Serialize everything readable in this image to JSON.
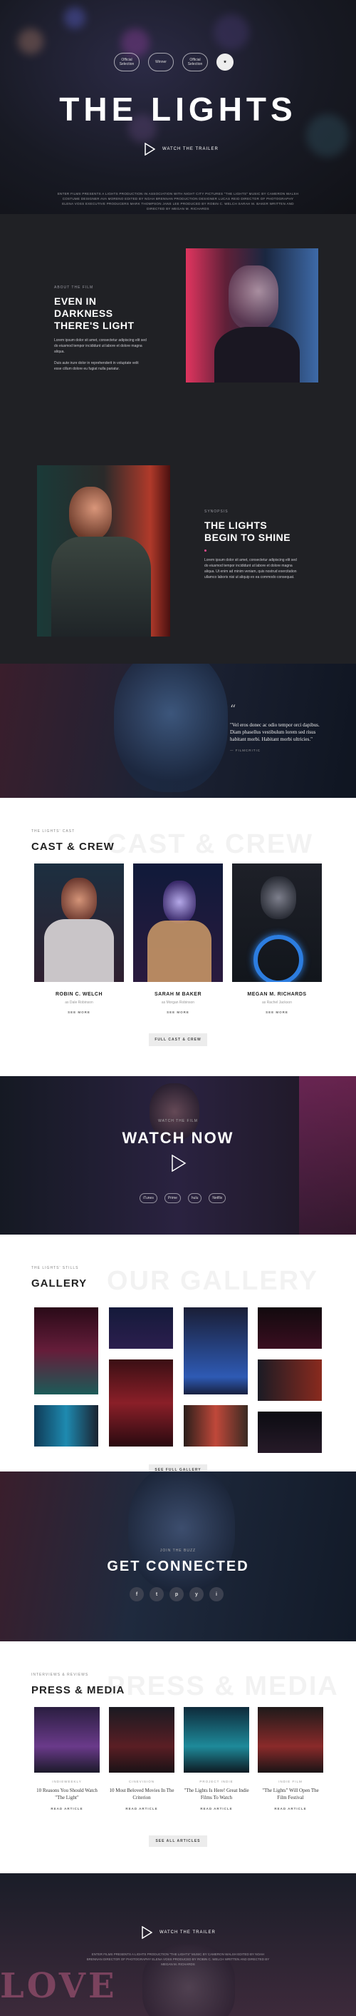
{
  "hero": {
    "awards": [
      "Official Selection",
      "Winner",
      "Official Selection"
    ],
    "title": "THE LIGHTS",
    "trailer_label": "WATCH THE TRAILER",
    "credits": "ENTER FILMS PRESENTS A LIGHTS PRODUCTION IN ASSOCIATION WITH NIGHT CITY PICTURES \"THE LIGHTS\" MUSIC BY CAMERON WALSH COSTUME DESIGNER AVA MORENO EDITED BY NOAH BRENNAN PRODUCTION DESIGNER LUCAS REID DIRECTOR OF PHOTOGRAPHY ELENA VOSS EXECUTIVE PRODUCERS MARK THOMPSON JANE LEE PRODUCED BY ROBIN C. WELCH SARAH M. BAKER WRITTEN AND DIRECTED BY MEGAN M. RICHARDS"
  },
  "about": {
    "eyebrow": "ABOUT THE FILM",
    "title": "EVEN IN DARKNESS THERE'S LIGHT",
    "p1": "Lorem ipsum dolor sit amet, consectetur adipiscing elit sed do eiusmod tempor incididunt ut labore et dolore magna aliqua.",
    "p2": "Duis aute irure dolor in reprehenderit in voluptate velit esse cillum dolore eu fugiat nulla pariatur."
  },
  "shine": {
    "eyebrow": "SYNOPSIS",
    "title": "THE LIGHTS BEGIN TO SHINE",
    "p1": "Lorem ipsum dolor sit amet, consectetur adipiscing elit sed do eiusmod tempor incididunt ut labore et dolore magna aliqua. Ut enim ad minim veniam, quis nostrud exercitation ullamco laboris nisi ut aliquip ex ea commodo consequat."
  },
  "quote": {
    "text": "\"Vel eros donec ac odio tempor orci dapibus. Diam phasellus vestibulum lorem sed risus habitant morbi. Habitant morbi ultricies.\"",
    "author": "— FILMCRITIC"
  },
  "cast": {
    "eyebrow": "THE LIGHTS' CAST",
    "title": "CAST & CREW",
    "ghost": "CAST & CREW",
    "members": [
      {
        "name": "ROBIN C. WELCH",
        "role": "as Dale Robinson",
        "link": "SEE MORE"
      },
      {
        "name": "SARAH M BAKER",
        "role": "as Morgan Robinson",
        "link": "SEE MORE"
      },
      {
        "name": "MEGAN M. RICHARDS",
        "role": "as Rachel Jackson",
        "link": "SEE MORE"
      }
    ],
    "button": "FULL CAST & CREW"
  },
  "watch": {
    "eyebrow": "WATCH THE FILM",
    "title": "WATCH NOW",
    "logos": [
      "iTunes",
      "Prime",
      "hulu",
      "Netflix"
    ]
  },
  "gallery": {
    "eyebrow": "THE LIGHTS' STILLS",
    "title": "GALLERY",
    "ghost": "OUR GALLERY",
    "button": "SEE FULL GALLERY"
  },
  "connected": {
    "eyebrow": "JOIN THE BUZZ",
    "title": "GET CONNECTED",
    "socials": [
      "f",
      "t",
      "p",
      "y",
      "i"
    ]
  },
  "press": {
    "eyebrow": "INTERVIEWS & REVIEWS",
    "title": "PRESS & MEDIA",
    "ghost": "PRESS & MEDIA",
    "items": [
      {
        "source": "INDIEWEEKLY",
        "headline": "10 Reasons You Should Watch \"The Light\"",
        "link": "READ ARTICLE"
      },
      {
        "source": "CINEVISION",
        "headline": "10 Most Beloved Movies In The Criterion",
        "link": "READ ARTICLE"
      },
      {
        "source": "PROJECT INDIE",
        "headline": "\"The Lights Is Here! Great Indie Films To Watch",
        "link": "READ ARTICLE"
      },
      {
        "source": "INDIE FILM",
        "headline": "\"The Lights\" Will Open The Film Festival",
        "link": "READ ARTICLE"
      }
    ],
    "button": "SEE ALL ARTICLES"
  },
  "footer": {
    "trailer_label": "WATCH THE TRAILER",
    "credits": "ENTER FILMS PRESENTS A LIGHTS PRODUCTION \"THE LIGHTS\" MUSIC BY CAMERON WALSH EDITED BY NOAH BRENNAN DIRECTOR OF PHOTOGRAPHY ELENA VOSS PRODUCED BY ROBIN C. WELCH WRITTEN AND DIRECTED BY MEGAN M. RICHARDS",
    "love": "LOVE"
  }
}
